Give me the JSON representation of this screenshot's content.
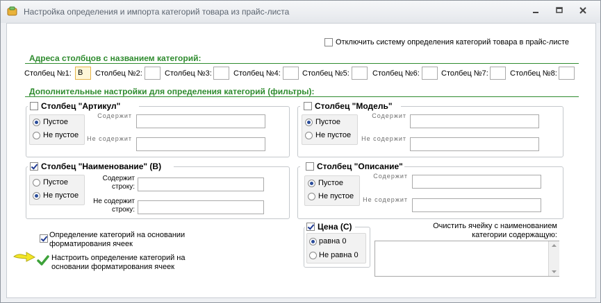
{
  "window": {
    "title": "Настройка определения и импорта категорий товара из прайс-листа",
    "minimize_icon": "minimize-icon",
    "maximize_icon": "maximize-icon",
    "close_icon": "close-icon"
  },
  "disable_system": {
    "label": "Отключить систему определения категорий товара в прайс-листе",
    "checked": false
  },
  "columns_section": {
    "heading": "Адреса столбцов с названием категорий:",
    "fields": [
      {
        "label": "Столбец №1:",
        "value": "B"
      },
      {
        "label": "Столбец №2:",
        "value": ""
      },
      {
        "label": "Столбец №3:",
        "value": ""
      },
      {
        "label": "Столбец №4:",
        "value": ""
      },
      {
        "label": "Столбец №5:",
        "value": ""
      },
      {
        "label": "Столбец №6:",
        "value": ""
      },
      {
        "label": "Столбец №7:",
        "value": ""
      },
      {
        "label": "Столбец №8:",
        "value": ""
      }
    ]
  },
  "filters_section": {
    "heading": "Дополнительные настройки для определения категорий (фильтры):"
  },
  "groups": {
    "article": {
      "title": "Столбец \"Артикул\"",
      "checked": false,
      "radio_empty": "Пустое",
      "radio_nonempty": "Не пустое",
      "selected": "empty",
      "contains_label": "Содержит",
      "not_contains_label": "Не содержит"
    },
    "model": {
      "title": "Столбец \"Модель\"",
      "checked": false,
      "radio_empty": "Пустое",
      "radio_nonempty": "Не пустое",
      "selected": "empty",
      "contains_label": "Содержит",
      "not_contains_label": "Не содержит"
    },
    "name": {
      "title": "Столбец \"Наименование\" (B)",
      "checked": true,
      "radio_empty": "Пустое",
      "radio_nonempty": "Не пустое",
      "selected": "nonempty",
      "contains_label_1": "Содержит",
      "contains_label_2": "строку:",
      "not_contains_label_1": "Не содержит",
      "not_contains_label_2": "строку:"
    },
    "description": {
      "title": "Столбец \"Описание\"",
      "checked": false,
      "radio_empty": "Пустое",
      "radio_nonempty": "Не пустое",
      "selected": "empty",
      "contains_label": "Содержит",
      "not_contains_label": "Не содержит"
    },
    "price": {
      "title": "Цена (C)",
      "checked": true,
      "radio_zero": "равна 0",
      "radio_nonzero": "Не равна 0",
      "selected": "zero"
    }
  },
  "format_detection": {
    "line1": "Определение категорий на основании",
    "line2": "форматирования ячеек",
    "checked": true
  },
  "format_setup": {
    "line1": "Настроить определение категорий на",
    "line2": "основании форматирования ячеек",
    "arrow_icon": "yellow-arrow-icon",
    "check_icon": "green-check-icon"
  },
  "clear_cell": {
    "line1": "Очистить ячейку с наименованием",
    "line2": "категории содержащую:",
    "value": ""
  }
}
